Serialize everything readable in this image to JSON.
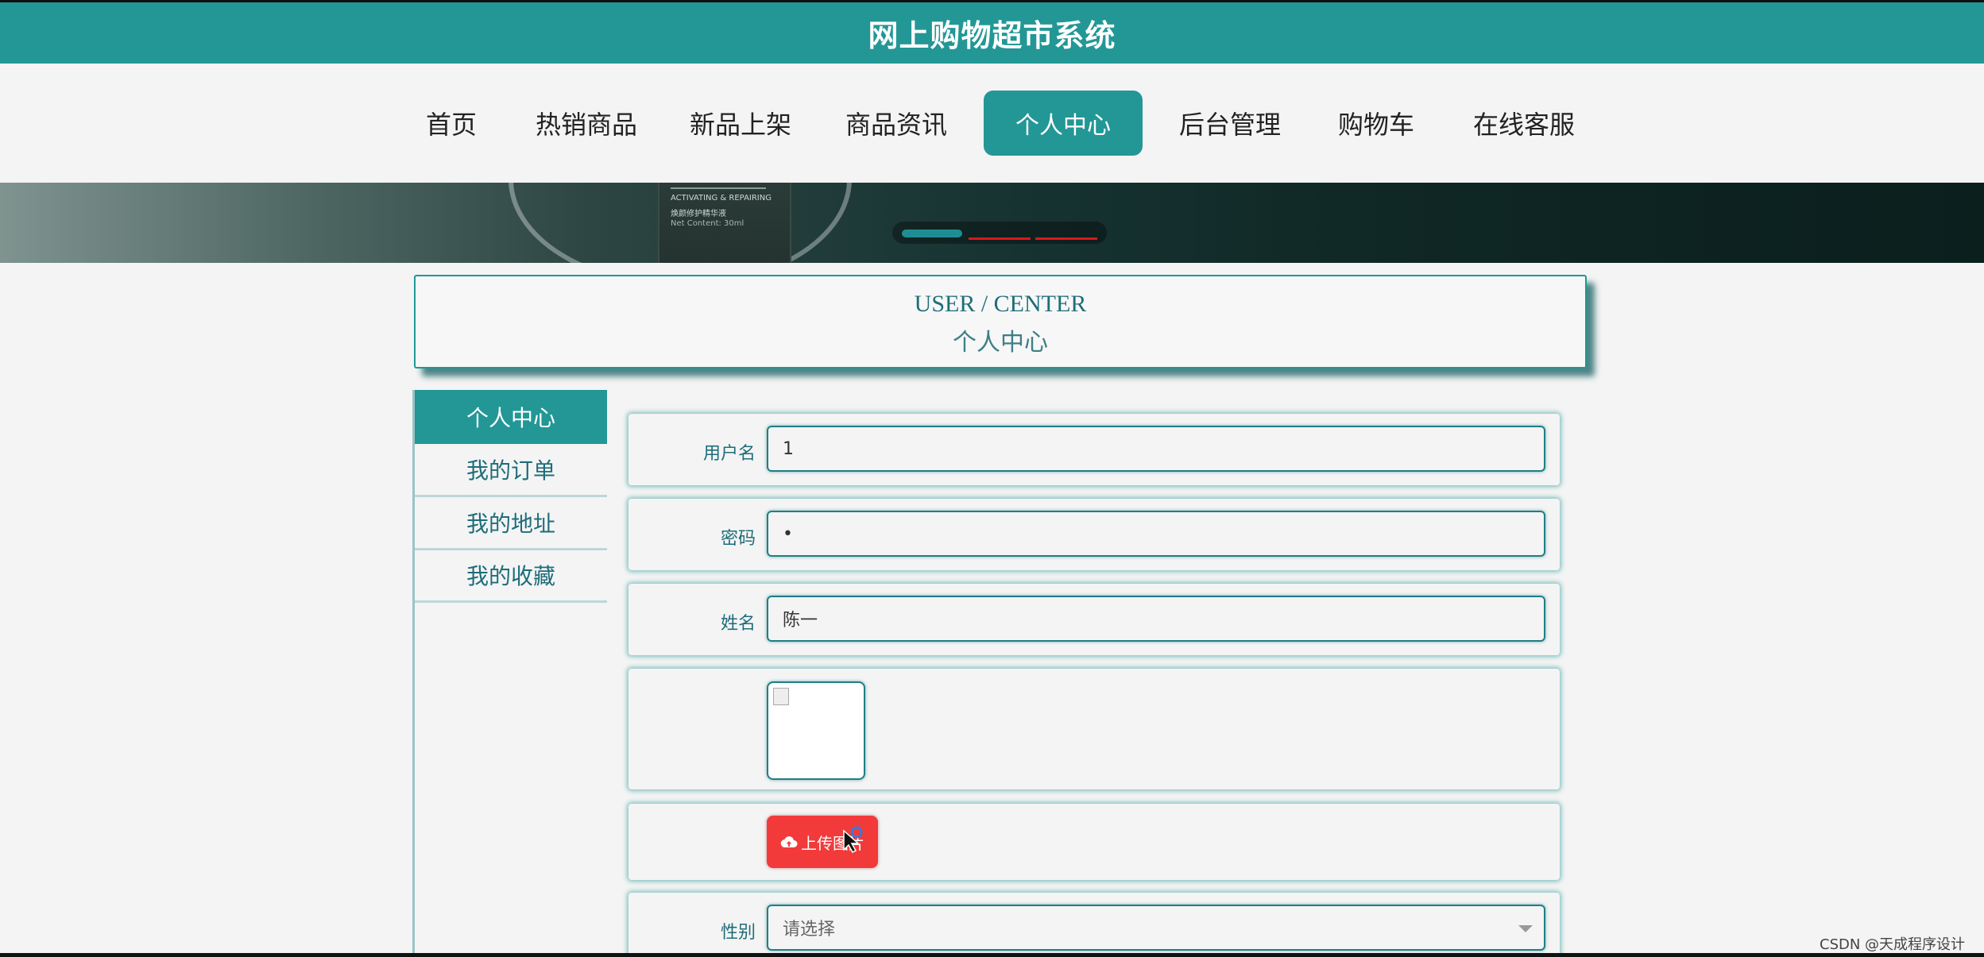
{
  "header": {
    "title": "网上购物超市系统"
  },
  "nav": {
    "items": [
      "首页",
      "热销商品",
      "新品上架",
      "商品资讯",
      "个人中心",
      "后台管理",
      "购物车",
      "在线客服"
    ],
    "active_index": 4
  },
  "banner": {
    "product_text_1": "ACTIVATING & REPAIRING",
    "product_text_2": "焕颜修护精华液",
    "product_text_3": "Net Content: 30ml",
    "active_dot": 1,
    "dot_count": 3
  },
  "title_box": {
    "en": "USER / CENTER",
    "cn": "个人中心"
  },
  "sidebar": {
    "items": [
      "个人中心",
      "我的订单",
      "我的地址",
      "我的收藏"
    ],
    "active_index": 0
  },
  "form": {
    "username": {
      "label": "用户名",
      "value": "1"
    },
    "password": {
      "label": "密码",
      "value": "•"
    },
    "name": {
      "label": "姓名",
      "value": "陈一"
    },
    "avatar": {
      "label": ""
    },
    "upload": {
      "label": "上传图片"
    },
    "gender": {
      "label": "性别",
      "placeholder": "请选择"
    }
  },
  "watermark": "CSDN @天成程序设计",
  "colors": {
    "primary": "#229796",
    "upload": "#f23a3a",
    "text": "#1e6d7a"
  }
}
